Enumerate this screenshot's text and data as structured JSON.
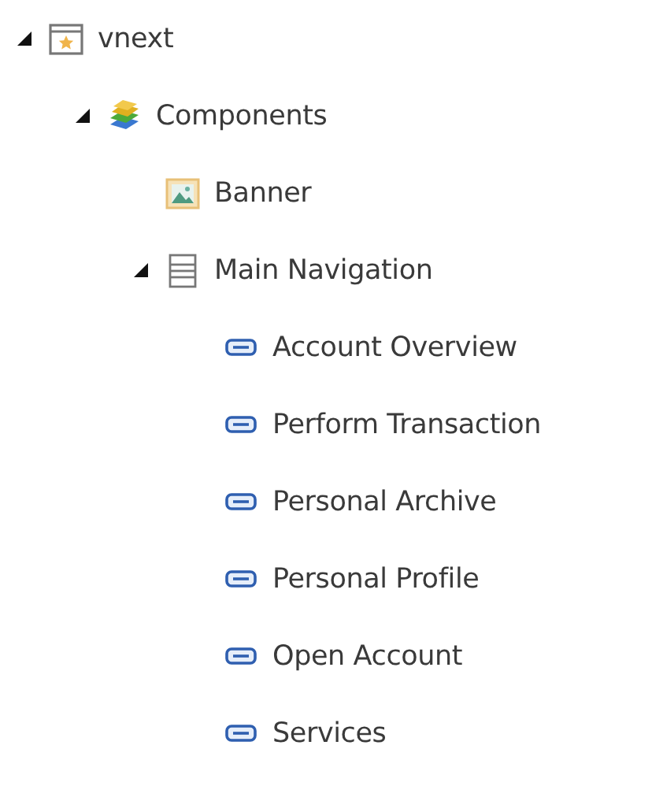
{
  "tree": [
    {
      "label": "vnext",
      "kind": "site",
      "expanded": true,
      "children": [
        {
          "label": "Components",
          "kind": "folder",
          "expanded": true,
          "children": [
            {
              "label": "Banner",
              "kind": "image"
            },
            {
              "label": "Main Navigation",
              "kind": "list",
              "expanded": true,
              "children": [
                {
                  "label": "Account Overview",
                  "kind": "link"
                },
                {
                  "label": "Perform Transaction",
                  "kind": "link"
                },
                {
                  "label": "Personal Archive",
                  "kind": "link"
                },
                {
                  "label": "Personal Profile",
                  "kind": "link"
                },
                {
                  "label": "Open Account",
                  "kind": "link"
                },
                {
                  "label": "Services",
                  "kind": "link"
                }
              ]
            }
          ]
        }
      ]
    }
  ]
}
